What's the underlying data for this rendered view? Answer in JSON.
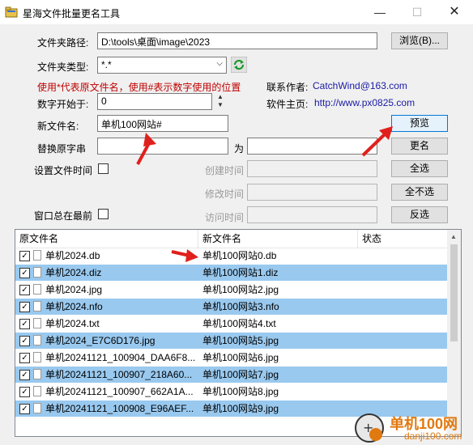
{
  "window": {
    "title": "星海文件批量更名工具"
  },
  "form": {
    "folder_path_label": "文件夹路径:",
    "folder_path_value": "D:\\tools\\桌面\\image\\2023",
    "browse_label": "浏览(B)...",
    "folder_type_label": "文件夹类型:",
    "folder_type_value": "*.*",
    "hint": "使用*代表原文件名，使用#表示数字使用的位置",
    "start_num_label": "数字开始于:",
    "start_num_value": "0",
    "new_name_label": "新文件名:",
    "new_name_value": "单机100网站#",
    "preview_label": "预览",
    "replace_label": "替换原字串",
    "replace_to_label": "为",
    "rename_label": "更名",
    "set_time_label": "设置文件时间",
    "select_all_label": "全选",
    "created_label": "创建时间",
    "unselect_all_label": "全不选",
    "modified_label": "修改时间",
    "invert_label": "反选",
    "always_top_label": "窗口总在最前",
    "accessed_label": "访问时间"
  },
  "contact": {
    "author_label": "联系作者:",
    "author_email": "CatchWind@163.com",
    "home_label": "软件主页:",
    "home_url": "http://www.px0825.com"
  },
  "table": {
    "headers": [
      "原文件名",
      "新文件名",
      "状态"
    ],
    "rows": [
      {
        "orig": "单机2024.db",
        "new": "单机100网站0.db",
        "sel": false
      },
      {
        "orig": "单机2024.diz",
        "new": "单机100网站1.diz",
        "sel": true
      },
      {
        "orig": "单机2024.jpg",
        "new": "单机100网站2.jpg",
        "sel": false
      },
      {
        "orig": "单机2024.nfo",
        "new": "单机100网站3.nfo",
        "sel": true
      },
      {
        "orig": "单机2024.txt",
        "new": "单机100网站4.txt",
        "sel": false
      },
      {
        "orig": "单机2024_E7C6D176.jpg",
        "new": "单机100网站5.jpg",
        "sel": true
      },
      {
        "orig": "单机20241121_100904_DAA6F8...",
        "new": "单机100网站6.jpg",
        "sel": false
      },
      {
        "orig": "单机20241121_100907_218A60...",
        "new": "单机100网站7.jpg",
        "sel": true
      },
      {
        "orig": "单机20241121_100907_662A1A...",
        "new": "单机100网站8.jpg",
        "sel": false
      },
      {
        "orig": "单机20241121_100908_E96AEF...",
        "new": "单机100网站9.jpg",
        "sel": true
      }
    ]
  },
  "watermark": {
    "text": "单机100网",
    "url": "danji100.com"
  },
  "colors": {
    "selection": "#99c9ef",
    "hint": "#c00000",
    "link": "#1a1aa6",
    "annotation_arrow": "#e0201c"
  }
}
